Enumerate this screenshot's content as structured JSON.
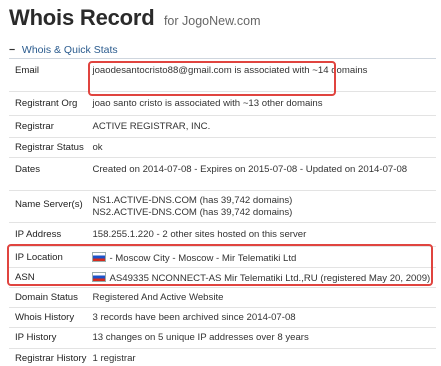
{
  "page": {
    "title": "Whois Record",
    "subtitle": "for JogoNew.com"
  },
  "section": {
    "toggle": "−",
    "title": "Whois & Quick Stats"
  },
  "rows": [
    {
      "label": "Email",
      "value": "joaodesantocristo88@gmail.com is associated with ~14 domains"
    },
    {
      "label": "Registrant Org",
      "value": "joao santo cristo is associated with ~13 other domains"
    },
    {
      "label": "Registrar",
      "value": "ACTIVE REGISTRAR, INC."
    },
    {
      "label": "Registrar Status",
      "value": "ok"
    },
    {
      "label": "Dates",
      "value": "Created on 2014-07-08 - Expires on 2015-07-08 - Updated on 2014-07-08"
    },
    {
      "label": "Name Server(s)",
      "value": "NS1.ACTIVE-DNS.COM (has 39,742 domains)",
      "value2": "NS2.ACTIVE-DNS.COM (has 39,742 domains)"
    },
    {
      "label": "IP Address",
      "value": "158.255.1.220 - 2 other sites hosted on this server"
    },
    {
      "label": "IP Location",
      "value": "- Moscow City - Moscow - Mir Telematiki Ltd"
    },
    {
      "label": "ASN",
      "value": "AS49335 NCONNECT-AS Mir Telematiki Ltd.,RU (registered May 20, 2009)"
    },
    {
      "label": "Domain Status",
      "value": "Registered And Active Website"
    },
    {
      "label": "Whois History",
      "value": "3 records have been archived since 2014-07-08"
    },
    {
      "label": "IP History",
      "value": "13 changes on 5 unique IP addresses over 8 years"
    },
    {
      "label": "Registrar History",
      "value": "1 registrar"
    }
  ],
  "colors": {
    "highlight": "#e0443f",
    "section_link": "#2a5b8e"
  },
  "icons": {
    "flag": "russia-flag-icon"
  }
}
